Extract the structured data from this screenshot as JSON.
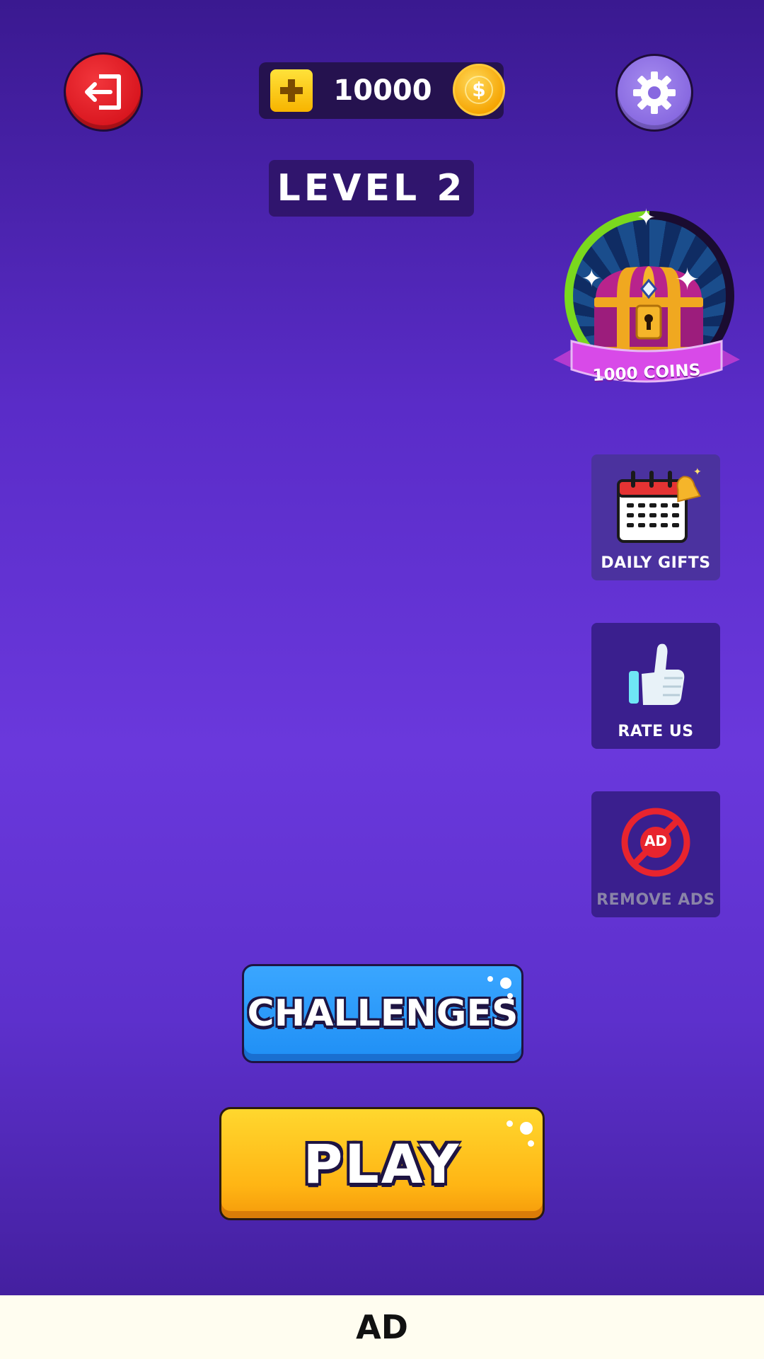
{
  "topbar": {
    "exit_icon": "exit-icon",
    "coins": "10000",
    "add_coins_icon": "plus-icon",
    "coin_icon": "coin-icon",
    "settings_icon": "gear-icon"
  },
  "level": {
    "label": "LEVEL 2"
  },
  "chest_reward": {
    "label": "1000 COINS",
    "icon": "treasure-chest-icon"
  },
  "side_menu": {
    "daily_gifts": {
      "label": "DAILY GIFTS",
      "icon": "calendar-bell-icon"
    },
    "rate_us": {
      "label": "RATE US",
      "icon": "thumbs-up-icon"
    },
    "remove_ads": {
      "label": "REMOVE ADS",
      "icon": "no-ads-icon",
      "badge": "AD"
    }
  },
  "buttons": {
    "challenges": "CHALLENGES",
    "play": "PLAY"
  },
  "ad_banner": {
    "label": "AD"
  },
  "colors": {
    "exit_button": "#d9161f",
    "settings_button": "#8768e0",
    "challenges_button": "#1f8ff5",
    "play_button": "#ffb514",
    "coin_gold": "#f5a300",
    "ribbon_magenta": "#d84ae8",
    "progress_green": "#7ad81e"
  }
}
